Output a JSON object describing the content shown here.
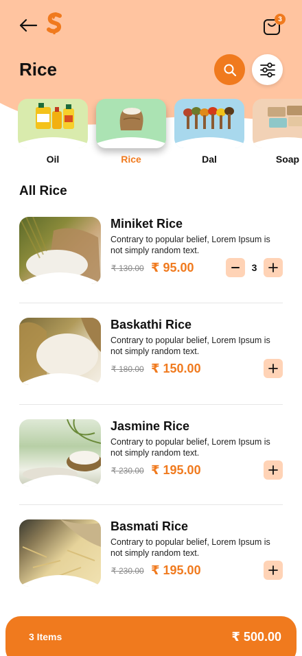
{
  "header": {
    "title": "Rice",
    "cart_count": "3"
  },
  "categories": [
    {
      "label": "Oil",
      "color": "#d9ebad",
      "active": false
    },
    {
      "label": "Rice",
      "color": "#abe3b3",
      "active": true
    },
    {
      "label": "Dal",
      "color": "#a8d8ed",
      "active": false
    },
    {
      "label": "Soap",
      "color": "#f2d2b6",
      "active": false
    }
  ],
  "section_title": "All Rice",
  "products": [
    {
      "name": "Miniket Rice",
      "description": "Contrary to popular belief, Lorem Ipsum is not simply random text.",
      "old_price": "₹ 130.00",
      "price": "₹ 95.00",
      "quantity": "3"
    },
    {
      "name": "Baskathi Rice",
      "description": "Contrary to popular belief, Lorem Ipsum is not simply random text.",
      "old_price": "₹ 180.00",
      "price": "₹ 150.00"
    },
    {
      "name": "Jasmine Rice",
      "description": "Contrary to popular belief, Lorem Ipsum is not simply random text.",
      "old_price": "₹ 230.00",
      "price": "₹ 195.00"
    },
    {
      "name": "Basmati Rice",
      "description": "Contrary to popular belief, Lorem Ipsum is not simply random text.",
      "old_price": "₹ 230.00",
      "price": "₹ 195.00"
    }
  ],
  "cart_bar": {
    "items_label": "3 Items",
    "total": "₹ 500.00"
  },
  "colors": {
    "accent": "#f07a1e",
    "header_bg": "#ffc4a0",
    "qty_button_bg": "#ffd3b6"
  }
}
